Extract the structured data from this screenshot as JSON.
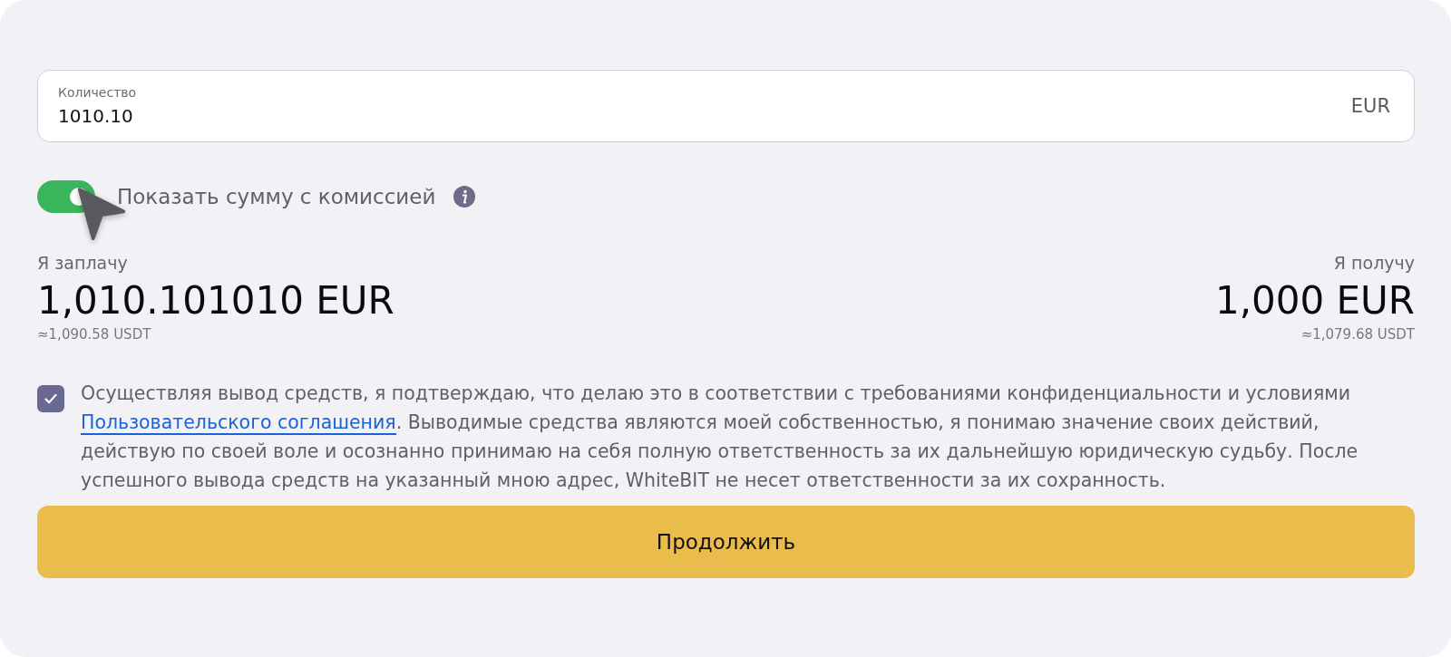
{
  "amount_field": {
    "label": "Количество",
    "value": "1010.10",
    "currency": "EUR"
  },
  "fee_toggle": {
    "on": true,
    "label": "Показать сумму с комиссией"
  },
  "pay": {
    "label": "Я заплачу",
    "amount": "1,010.101010 EUR",
    "approx": "≈1,090.58 USDT"
  },
  "receive": {
    "label": "Я получу",
    "amount": "1,000 EUR",
    "approx": "≈1,079.68 USDT"
  },
  "agreement": {
    "checked": true,
    "text_before": "Осуществляя вывод средств, я подтверждаю, что делаю это в соответствии с требованиями конфиденциальности и условиями",
    "link": "Пользовательского соглашения",
    "text_after": ". Выводимые средства являются моей собственностью, я понимаю значение своих действий, действую по своей воле и осознанно принимаю на себя полную ответственность за их дальнейшую юридическую судьбу. После успешного вывода средств на указанный мною адрес, WhiteBIT не несет ответственности за их сохранность."
  },
  "continue_button": "Продолжить"
}
